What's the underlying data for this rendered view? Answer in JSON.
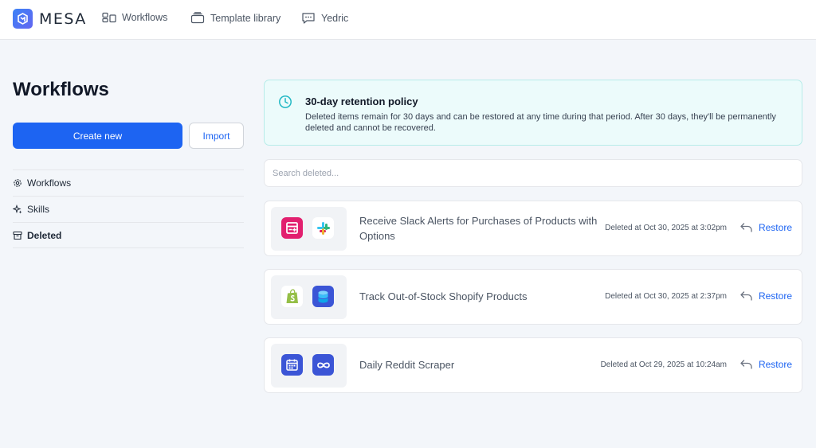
{
  "brand": {
    "name": "MESA"
  },
  "nav": {
    "workflows": "Workflows",
    "template_library": "Template library",
    "yedric": "Yedric"
  },
  "page": {
    "title": "Workflows",
    "create_label": "Create new",
    "import_label": "Import"
  },
  "sidebar": {
    "items": [
      {
        "label": "Workflows",
        "icon": "gear-icon"
      },
      {
        "label": "Skills",
        "icon": "sparkle-icon"
      },
      {
        "label": "Deleted",
        "icon": "archive-icon"
      }
    ]
  },
  "banner": {
    "title": "30-day retention policy",
    "text": "Deleted items remain for 30 days and can be restored at any time during that period. After 30 days, they'll be permanently deleted and cannot be recovered."
  },
  "search": {
    "placeholder": "Search deleted..."
  },
  "deleted_items": [
    {
      "title": "Receive Slack Alerts for Purchases of Products with Options",
      "deleted_at": "Deleted at Oct 30, 2025 at 3:02pm",
      "restore_label": "Restore",
      "apps": [
        "form-builder-icon",
        "slack-icon"
      ]
    },
    {
      "title": "Track Out-of-Stock Shopify Products",
      "deleted_at": "Deleted at Oct 30, 2025 at 2:37pm",
      "restore_label": "Restore",
      "apps": [
        "shopify-icon",
        "database-icon"
      ]
    },
    {
      "title": "Daily Reddit Scraper",
      "deleted_at": "Deleted at Oct 29, 2025 at 10:24am",
      "restore_label": "Restore",
      "apps": [
        "calendar-icon",
        "loop-icon"
      ]
    }
  ],
  "colors": {
    "primary": "#1d64f2",
    "banner_bg": "#ecfbfb",
    "banner_border": "#b7ece9",
    "page_bg": "#f3f6fa"
  }
}
